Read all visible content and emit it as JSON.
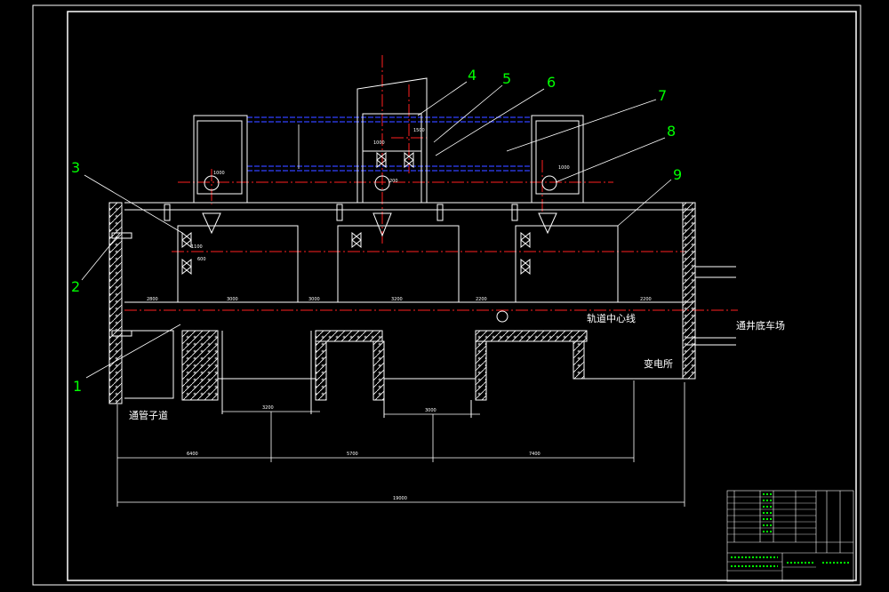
{
  "drawing": {
    "part_numbers": [
      "1",
      "2",
      "3",
      "4",
      "5",
      "6",
      "7",
      "8",
      "9"
    ],
    "labels": {
      "track_centerline": "轨道中心线",
      "shaft_bottom_yard": "通井底车场",
      "substation": "变电所",
      "pipe_passage": "通管子道"
    },
    "dimensions": {
      "d_2800": "2800",
      "d_3000": "3000",
      "d_3000b": "3000",
      "d_3200": "3200",
      "d_2200": "2200",
      "d_2200b": "2200",
      "d_1100": "1100",
      "d_600": "600",
      "d_1000a": "1000",
      "d_1000b": "1000",
      "d_1000c": "1000",
      "d_1500": "1500",
      "d_200": "200",
      "d_6400": "6400",
      "d_5700": "5700",
      "d_7400": "7400",
      "d_19000": "19000"
    }
  },
  "colors": {
    "background": "#000000",
    "outline": "#ffffff",
    "centerline": "#ff2020",
    "pipe": "#3040ff",
    "leader_green": "#00ff00"
  }
}
